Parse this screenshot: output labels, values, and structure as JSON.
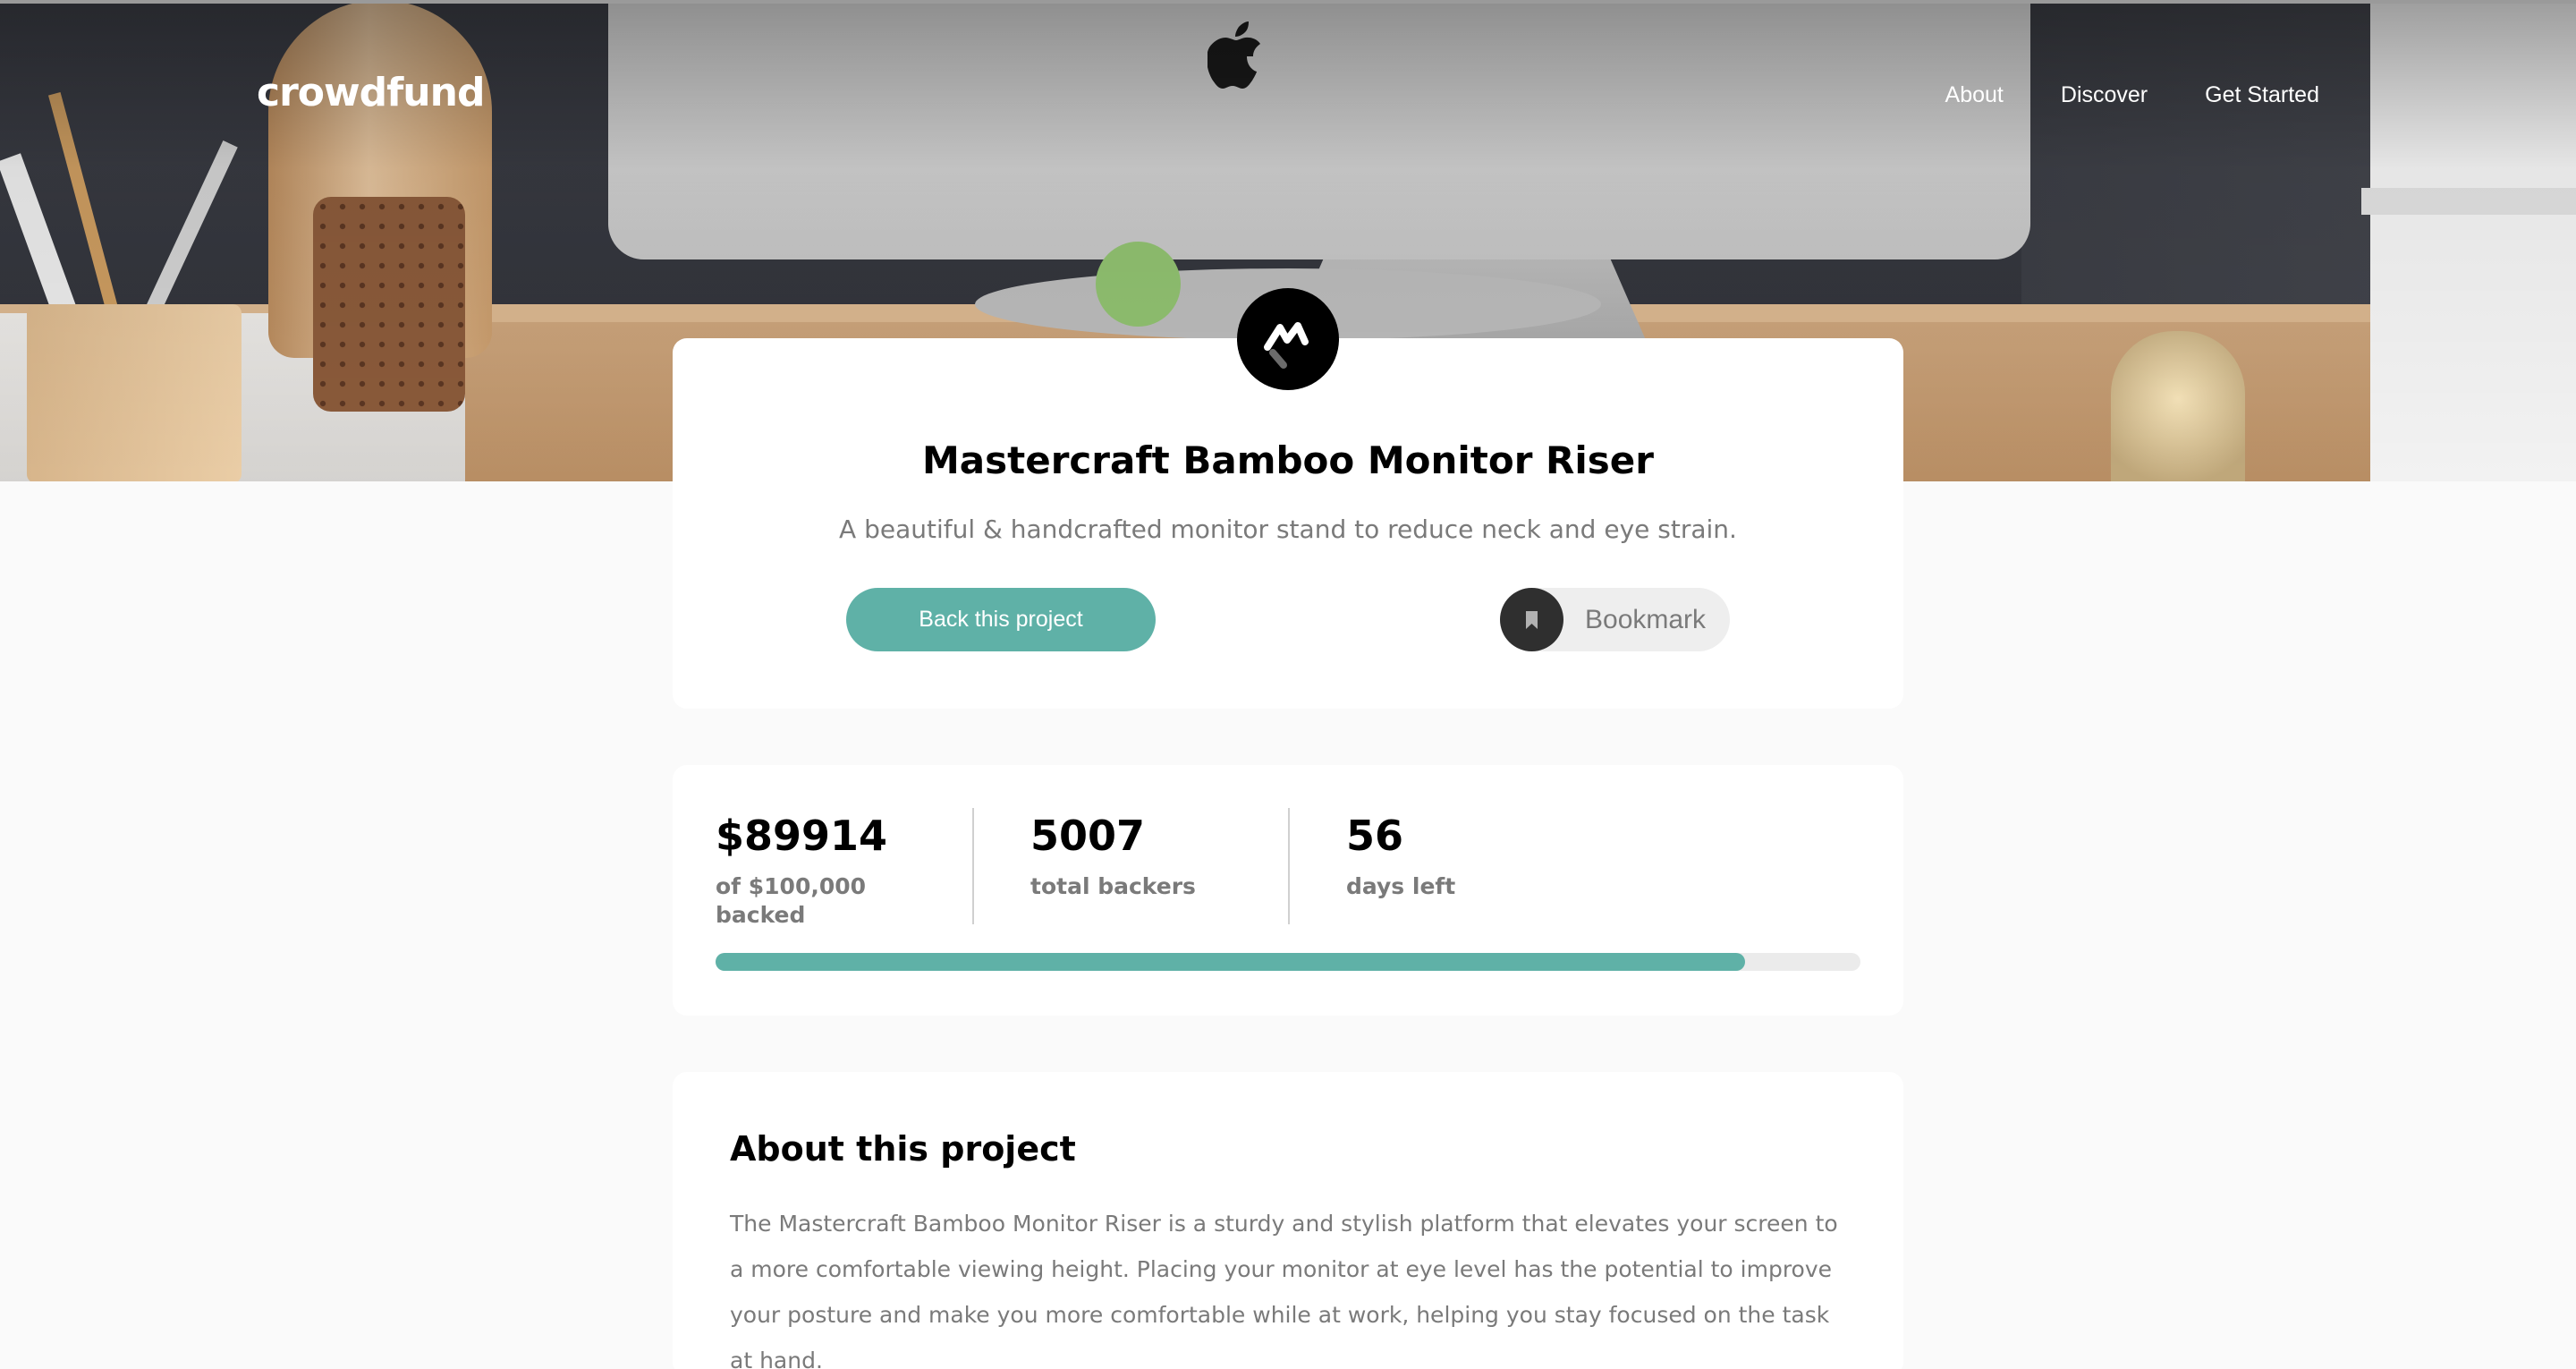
{
  "header": {
    "logo": "crowdfund",
    "nav": [
      "About",
      "Discover",
      "Get Started"
    ]
  },
  "project": {
    "title": "Mastercraft Bamboo Monitor Riser",
    "subtitle": "A beautiful & handcrafted monitor stand to reduce neck and eye strain.",
    "back_label": "Back this project",
    "bookmark_label": "Bookmark"
  },
  "stats": {
    "backed_value": "$89914",
    "backed_label": "of $100,000 backed",
    "backers_value": "5007",
    "backers_label": "total backers",
    "days_value": "56",
    "days_label": "days left",
    "progress_fraction": 0.89914
  },
  "about": {
    "title": "About this project",
    "text": "The Mastercraft Bamboo Monitor Riser is a sturdy and stylish platform that elevates your screen to a more comfortable viewing height. Placing your monitor at eye level has the potential to improve your posture and make you more comfortable while at work, helping you stay focused on the task at hand."
  },
  "colors": {
    "accent": "#5fb1a7",
    "background": "#fafafa",
    "muted_text": "#7a7a7a"
  },
  "icons": {
    "bookmark": "bookmark-icon",
    "project_logo": "mastercraft-logo-icon"
  }
}
